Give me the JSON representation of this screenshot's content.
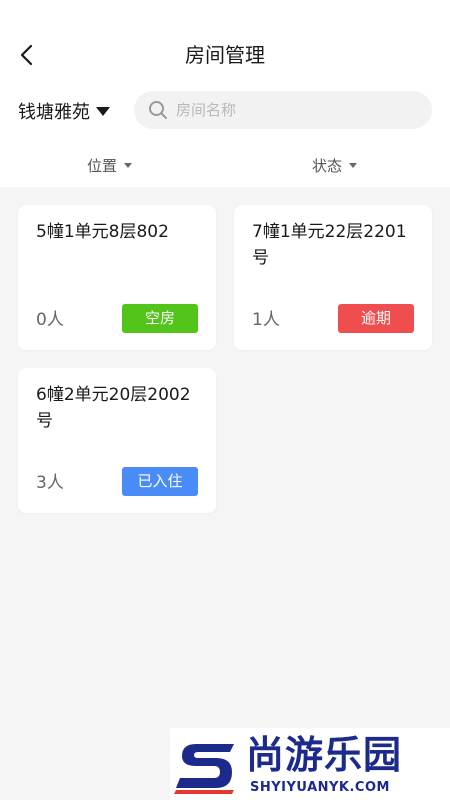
{
  "header": {
    "title": "房间管理",
    "back_icon": "chevron-left-icon"
  },
  "toolbar": {
    "community": "钱塘雅苑",
    "search_placeholder": "房间名称",
    "search_value": ""
  },
  "filters": {
    "location_label": "位置",
    "status_label": "状态"
  },
  "rooms": [
    {
      "name": "5幢1单元8层802",
      "count": "0人",
      "status": "空房",
      "status_color": "#52c41a"
    },
    {
      "name": "7幢1单元22层2201号",
      "count": "1人",
      "status": "逾期",
      "status_color": "#f04e4e"
    },
    {
      "name": "6幢2单元20层2002号",
      "count": "3人",
      "status": "已入住",
      "status_color": "#4a8cf7"
    }
  ],
  "watermark": {
    "brand": "尚游乐园",
    "url": "SHYIYUANYK.COM"
  }
}
